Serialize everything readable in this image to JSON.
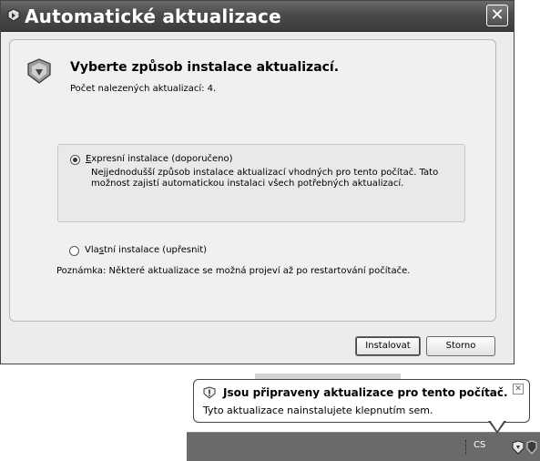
{
  "window": {
    "title": "Automatické aktualizace",
    "close_glyph": "✕",
    "icon": "windows-update-icon"
  },
  "main": {
    "heading": "Vyberte způsob instalace aktualizací.",
    "subtext": "Počet nalezených aktualizací: 4.",
    "options": [
      {
        "label_prefix": "",
        "label_access": "E",
        "label_rest": "xpresní instalace (doporučeno)",
        "selected": true,
        "description": "Nejjednodušší způsob instalace aktualizací vhodných pro tento počítač. Tato možnost zajistí automatickou instalaci všech potřebných aktualizací."
      },
      {
        "label_prefix": "Vla",
        "label_access": "s",
        "label_rest": "tní instalace (upřesnit)",
        "selected": false
      }
    ],
    "note": "Poznámka:  Některé aktualizace se možná projeví až po restartování počítače."
  },
  "buttons": {
    "install": "Instalovat",
    "cancel": "Storno"
  },
  "balloon": {
    "title": "Jsou připraveny aktualizace pro tento počítač.",
    "text": "Tyto aktualizace nainstalujete klepnutím sem.",
    "close_glyph": "✕"
  },
  "taskbar": {
    "language": "CS"
  }
}
